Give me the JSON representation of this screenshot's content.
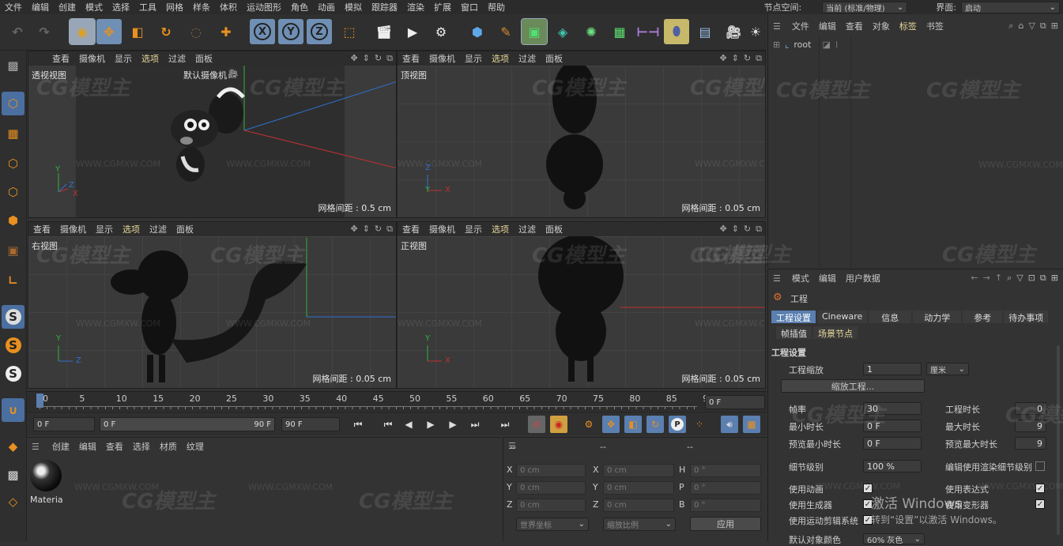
{
  "menubar": {
    "items": [
      "文件",
      "编辑",
      "创建",
      "模式",
      "选择",
      "工具",
      "网格",
      "样条",
      "体积",
      "运动图形",
      "角色",
      "动画",
      "模拟",
      "跟踪器",
      "渲染",
      "扩展",
      "窗口",
      "帮助"
    ],
    "node_space_label": "节点空间:",
    "node_space_value": "当前 (标准/物理)",
    "layout_label": "界面:",
    "layout_value": "启动"
  },
  "toolbar": {
    "x_label": "X",
    "y_label": "Y",
    "z_label": "Z"
  },
  "viewports": [
    {
      "menu": [
        "查看",
        "摄像机",
        "显示",
        "选项",
        "过滤",
        "面板"
      ],
      "name": "透视视图",
      "camera": "默认摄像机",
      "grid": "网格间距 : 0.5 cm",
      "axes": [
        "Y",
        "Z",
        "X"
      ]
    },
    {
      "menu": [
        "查看",
        "摄像机",
        "显示",
        "选项",
        "过滤",
        "面板"
      ],
      "name": "顶视图",
      "grid": "网格间距 : 0.05 cm",
      "axes": [
        "Z",
        "Y",
        "X"
      ]
    },
    {
      "menu": [
        "查看",
        "摄像机",
        "显示",
        "选项",
        "过滤",
        "面板"
      ],
      "name": "右视图",
      "grid": "网格间距 : 0.05 cm",
      "axes": [
        "Y",
        "Z"
      ]
    },
    {
      "menu": [
        "查看",
        "摄像机",
        "显示",
        "选项",
        "过滤",
        "面板"
      ],
      "name": "正视图",
      "grid": "网格间距 : 0.05 cm",
      "axes": [
        "Y",
        "X"
      ]
    }
  ],
  "timeline": {
    "ticks": [
      "0",
      "5",
      "10",
      "15",
      "20",
      "25",
      "30",
      "35",
      "40",
      "45",
      "50",
      "55",
      "60",
      "65",
      "70",
      "75",
      "80",
      "85",
      "90"
    ],
    "current_frame": "0 F"
  },
  "transport": {
    "start": "0 F",
    "range_start": "0 F",
    "range_end": "90 F",
    "end": "90 F"
  },
  "material_manager": {
    "menu": [
      "创建",
      "编辑",
      "查看",
      "选择",
      "材质",
      "纹理"
    ],
    "materials": [
      {
        "name": "Materia"
      }
    ]
  },
  "coordinates": {
    "header_a": "--",
    "header_b": "--",
    "header_c": "--",
    "rows": [
      {
        "a_label": "X",
        "a_value": "0 cm",
        "b_label": "X",
        "b_value": "0 cm",
        "c_label": "H",
        "c_value": "0 °"
      },
      {
        "a_label": "Y",
        "a_value": "0 cm",
        "b_label": "Y",
        "b_value": "0 cm",
        "c_label": "P",
        "c_value": "0 °"
      },
      {
        "a_label": "Z",
        "a_value": "0 cm",
        "b_label": "Z",
        "b_value": "0 cm",
        "c_label": "B",
        "c_value": "0 °"
      }
    ],
    "world_coords": "世界坐标",
    "scale_ratio": "缩放比例",
    "apply": "应用"
  },
  "object_manager": {
    "menu": [
      "文件",
      "编辑",
      "查看",
      "对象",
      "标签",
      "书签"
    ],
    "root": "root"
  },
  "attributes": {
    "menu": [
      "模式",
      "编辑",
      "用户数据"
    ],
    "title": "工程",
    "tabs": [
      "工程设置",
      "Cineware",
      "信息",
      "动力学",
      "参考",
      "待办事项"
    ],
    "tabs2": [
      "帧插值",
      "场景节点"
    ],
    "section": "工程设置",
    "project_scale_label": "工程缩放",
    "project_scale_value": "1",
    "project_scale_unit": "厘米",
    "scale_project_button": "缩放工程...",
    "fps_label": "帧率",
    "fps_value": "30",
    "project_duration_label": "工程时长",
    "project_duration_value": "0",
    "min_time_label": "最小时长",
    "min_time_value": "0 F",
    "max_time_label": "最大时长",
    "max_time_value": "9",
    "preview_min_label": "预览最小时长",
    "preview_min_value": "0 F",
    "preview_max_label": "预览最大时长",
    "preview_max_value": "9",
    "lod_label": "细节级别",
    "lod_value": "100 %",
    "render_lod_label": "编辑使用渲染细节级别",
    "use_animation_label": "使用动画",
    "use_expression_label": "使用表达式",
    "use_generators_label": "使用生成器",
    "use_deformers_label": "使用变形器",
    "use_motion_label": "使用运动剪辑系统",
    "default_color_label": "默认对象颜色",
    "default_color_value": "60% 灰色"
  },
  "overlay": {
    "activate_title": "激活 Windows",
    "activate_sub": "转到“设置”以激活 Windows。"
  },
  "watermarks": {
    "logo": "CG模型主",
    "url": "WWW.CGMXW.COM"
  },
  "colors": {
    "accent": "#5a7fb0",
    "highlight_text": "#e8d79a",
    "axis_x": "#c03030",
    "axis_y": "#30b040",
    "axis_z": "#3070d0"
  }
}
